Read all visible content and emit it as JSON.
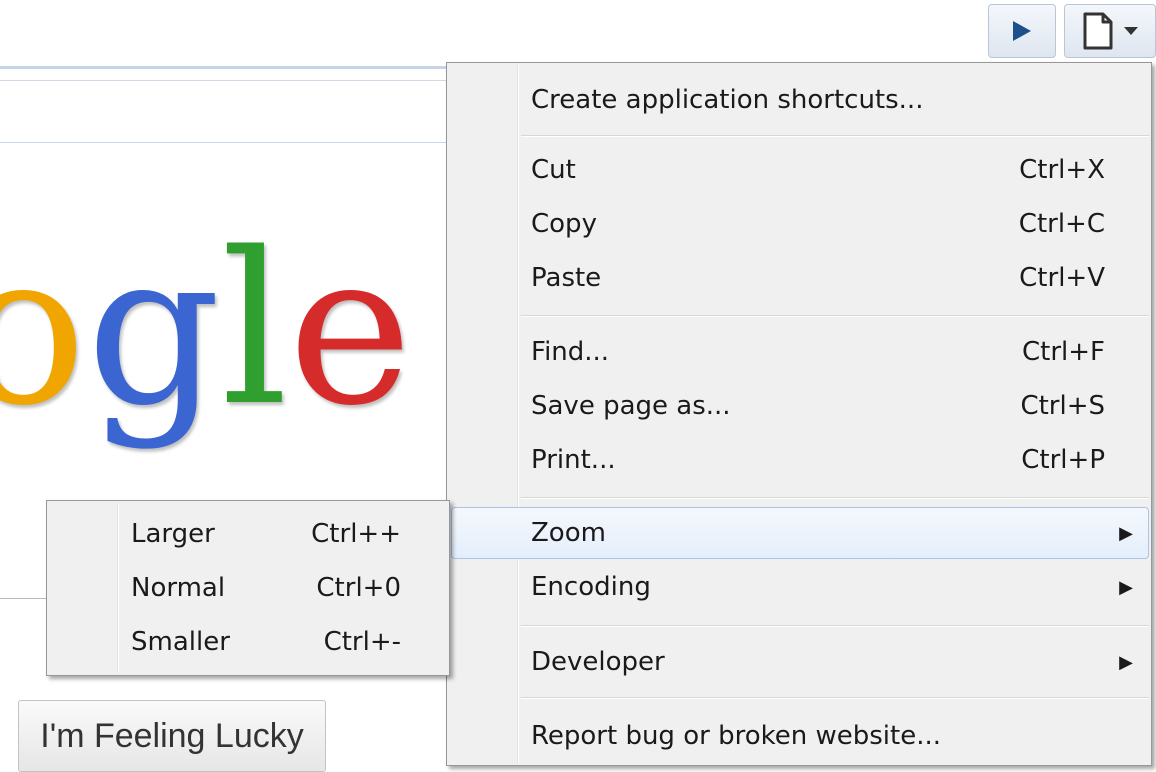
{
  "toolbar": {
    "go_icon": "play-icon",
    "page_icon": "page-icon",
    "page_dropdown_icon": "chevron-down-icon"
  },
  "logo": {
    "letters": [
      "o",
      "g",
      "l",
      "e"
    ],
    "colors": [
      "#f0a500",
      "#3b66d1",
      "#2fa02f",
      "#d62b2b"
    ]
  },
  "lucky_label": "I'm Feeling Lucky",
  "menu": {
    "create_shortcuts": "Create application shortcuts...",
    "cut": {
      "label": "Cut",
      "shortcut": "Ctrl+X"
    },
    "copy": {
      "label": "Copy",
      "shortcut": "Ctrl+C"
    },
    "paste": {
      "label": "Paste",
      "shortcut": "Ctrl+V"
    },
    "find": {
      "label": "Find...",
      "shortcut": "Ctrl+F"
    },
    "save": {
      "label": "Save page as...",
      "shortcut": "Ctrl+S"
    },
    "print": {
      "label": "Print...",
      "shortcut": "Ctrl+P"
    },
    "zoom": {
      "label": "Zoom"
    },
    "encoding": {
      "label": "Encoding"
    },
    "developer": {
      "label": "Developer"
    },
    "report": "Report bug or broken website...",
    "submenu_arrow": "▶"
  },
  "zoom_submenu": {
    "larger": {
      "label": "Larger",
      "shortcut": "Ctrl++"
    },
    "normal": {
      "label": "Normal",
      "shortcut": "Ctrl+0"
    },
    "smaller": {
      "label": "Smaller",
      "shortcut": "Ctrl+-"
    }
  }
}
